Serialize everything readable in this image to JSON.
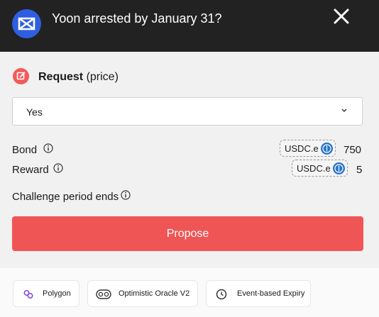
{
  "header": {
    "title": "Yoon arrested by January 31?",
    "logo_icon": "uma-logo-icon",
    "close_icon": "close-icon"
  },
  "request": {
    "label_bold": "Request",
    "label_rest": " (price)",
    "icon": "edit-icon"
  },
  "select": {
    "value": "Yes",
    "chevron_icon": "chevron-down-icon"
  },
  "bond": {
    "label": "Bond",
    "token": "USDC.e",
    "amount": "750"
  },
  "reward": {
    "label": "Reward",
    "token": "USDC.e",
    "amount": "5"
  },
  "challenge": {
    "label": "Challenge period ends"
  },
  "propose": {
    "label": "Propose"
  },
  "footer": {
    "chips": [
      {
        "label": "Polygon",
        "icon": "polygon-icon"
      },
      {
        "label": "Optimistic Oracle V2",
        "icon": "oracle-icon"
      },
      {
        "label": "Event-based Expiry",
        "icon": "clock-icon"
      }
    ]
  },
  "colors": {
    "header_bg": "#222222",
    "accent_red": "#f05555",
    "logo_blue": "#2f5fe0",
    "usdc_blue": "#2775ca"
  }
}
